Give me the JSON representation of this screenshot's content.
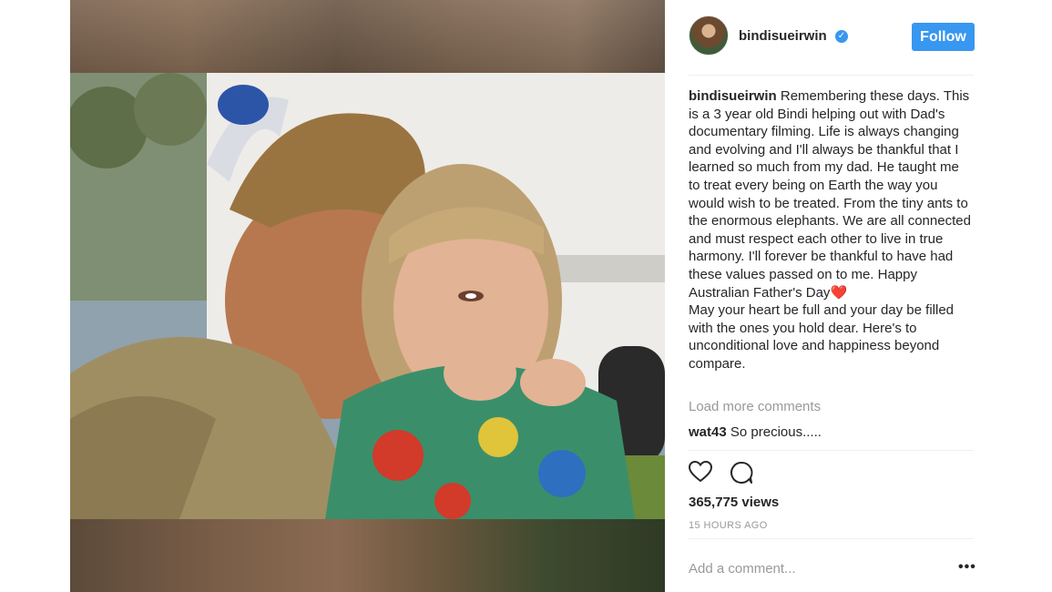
{
  "post": {
    "username": "bindisueirwin",
    "verified_icon": "verified-badge-icon",
    "follow_label": "Follow",
    "caption_username": "bindisueirwin",
    "caption_text": " Remembering these days. This is a 3 year old Bindi helping out with Dad's documentary filming. Life is always changing and evolving and I'll always be thankful that I learned so much from my dad. He taught me to treat every being on Earth the way you would wish to be treated. From the tiny ants to the enormous elephants. We are all connected and must respect each other to live in true harmony. I'll forever be thankful to have had these values passed on to me. Happy Australian Father's Day",
    "caption_emoji": "❤️",
    "caption_text_2": "May your heart be full and your day be filled with the ones you hold dear. Here's to unconditional love and happiness beyond compare.",
    "load_more": "Load more comments",
    "comments": [
      {
        "user": "wat43",
        "text": " So precious....."
      }
    ],
    "views": "365,775 views",
    "timestamp": "15 HOURS AGO",
    "add_comment_placeholder": "Add a comment...",
    "more_label": "•••"
  },
  "icons": {
    "like": "heart-outline-icon",
    "comment": "comment-bubble-icon",
    "more": "more-options-icon"
  },
  "colors": {
    "accent": "#3897f0",
    "text": "#262626",
    "muted": "#999999",
    "divider": "#efefef"
  }
}
